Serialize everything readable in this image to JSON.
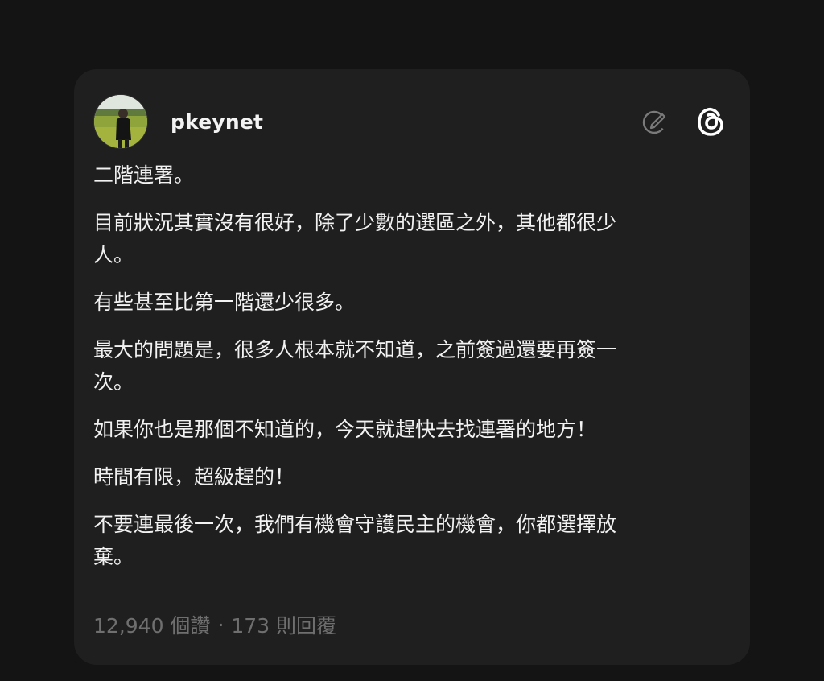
{
  "post": {
    "username": "pkeynet",
    "paragraphs": [
      "二階連署。",
      "目前狀況其實沒有很好，除了少數的選區之外，其他都很少\n人。",
      "有些甚至比第一階還少很多。",
      "最大的問題是，很多人根本就不知道，之前簽過還要再簽一\n次。",
      "如果你也是那個不知道的，今天就趕快去找連署的地方！",
      "時間有限，超級趕的！",
      "不要連最後一次，我們有機會守護民主的機會，你都選擇放\n棄。"
    ],
    "stats": {
      "views": "12,940 個讚",
      "separator": "·",
      "replies": "173 則回覆"
    }
  },
  "icons": {
    "edit": "compose-edit-icon",
    "threads": "threads-logo-icon"
  },
  "colors": {
    "background": "#141414",
    "card": "#1f1f1f",
    "text": "#f2f2f2",
    "muted": "#6f6f6f"
  }
}
